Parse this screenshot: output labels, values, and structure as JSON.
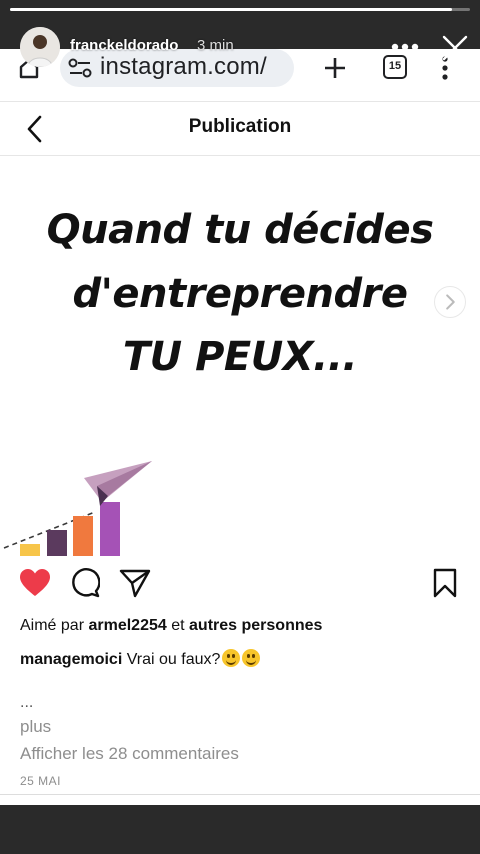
{
  "story": {
    "username": "franckeldorado",
    "time": "3 min",
    "progress": 0.96
  },
  "browser": {
    "url": "instagram.com/",
    "tab_count": "15",
    "icons": [
      "home-icon",
      "site-settings-icon",
      "plus-icon",
      "tabs-icon",
      "more-vert-icon"
    ]
  },
  "ig": {
    "title": "Publication"
  },
  "post": {
    "headline_line1": "Quand tu décides",
    "headline_line2": "d'entreprendre",
    "headline_line3": "TU PEUX...",
    "colors": {
      "bar1": "#f7c54a",
      "bar2": "#5b3a5e",
      "bar3": "#f0793e",
      "bar4": "#a552b6",
      "plane": "#c6a0bf",
      "heart": "#ed3b4a"
    }
  },
  "likes": {
    "prefix": "Aimé par",
    "user": "armel2254",
    "middle": "et",
    "rest": "autres personnes"
  },
  "caption": {
    "user": "managemoici",
    "text": "Vrai ou faux?"
  },
  "ellipsis": "...",
  "more": "plus",
  "comments_link": "Afficher les 28 commentaires",
  "date": "25 MAI"
}
